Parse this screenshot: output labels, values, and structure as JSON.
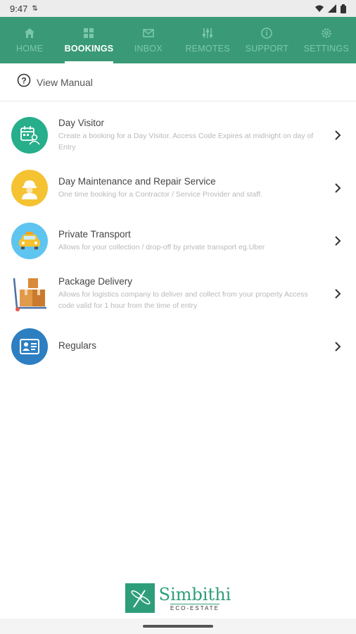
{
  "status_bar": {
    "time": "9:47"
  },
  "tabs": [
    {
      "label": "HOME",
      "icon": "home-icon",
      "active": false
    },
    {
      "label": "BOOKINGS",
      "icon": "grid-icon",
      "active": true
    },
    {
      "label": "INBOX",
      "icon": "mail-icon",
      "active": false
    },
    {
      "label": "REMOTES",
      "icon": "sliders-icon",
      "active": false
    },
    {
      "label": "SUPPORT",
      "icon": "info-icon",
      "active": false
    },
    {
      "label": "SETTINGS",
      "icon": "gear-icon",
      "active": false
    }
  ],
  "manual": {
    "label": "View Manual",
    "icon": "help-circle-icon"
  },
  "items": [
    {
      "title": "Day Visitor",
      "description": "Create a booking for a Day Visitor. Access Code Expires at midnight on day of Entry",
      "icon": "calendar-visitor-icon",
      "color": "#27ae8a"
    },
    {
      "title": "Day Maintenance and Repair Service",
      "description": "One time booking for a Contractor / Service Provider and staff.",
      "icon": "worker-icon",
      "color": "#f5c232"
    },
    {
      "title": "Private Transport",
      "description": "Allows for your  collection / drop-off by private transport eg.Uber",
      "icon": "taxi-icon",
      "color": "#5ec4f0"
    },
    {
      "title": "Package Delivery",
      "description": "Allows for logistics company to deliver and collect from your property Access code valid for 1 hour from the time of entry",
      "icon": "boxes-trolley-icon",
      "color": "#d98a3a"
    },
    {
      "title": "Regulars",
      "description": "",
      "icon": "id-card-icon",
      "color": "#2d7fc1"
    }
  ],
  "footer": {
    "logo_name": "Simbithi",
    "logo_sub": "ECO-ESTATE"
  }
}
